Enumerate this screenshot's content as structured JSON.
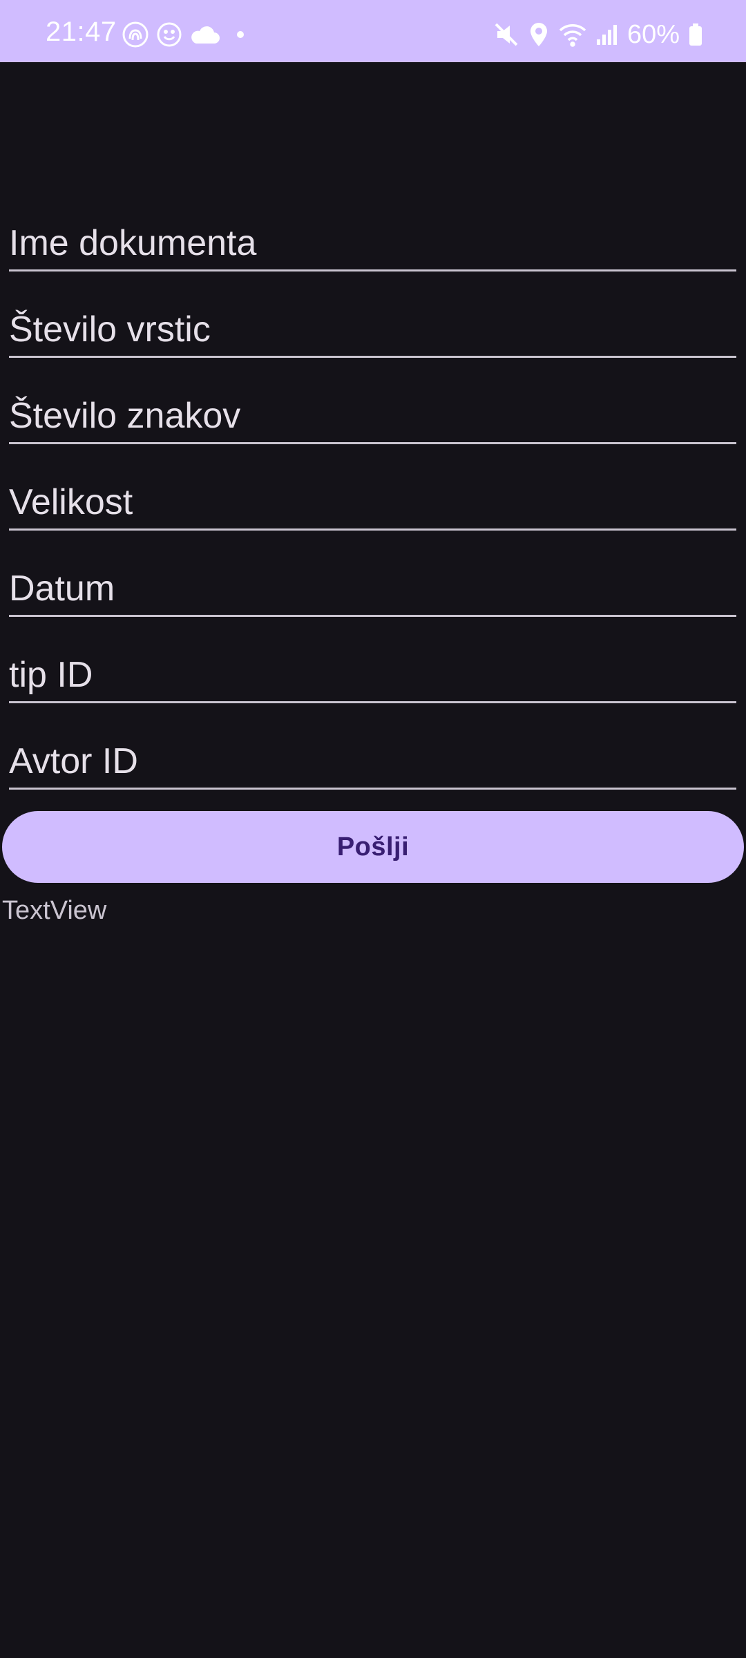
{
  "status_bar": {
    "time": "21:47",
    "battery": "60%",
    "left_icons": [
      "fingerprint-icon",
      "face-icon",
      "cloud-icon",
      "dot-icon"
    ],
    "right_icons": [
      "mute-icon",
      "location-icon",
      "wifi-icon",
      "signal-icon",
      "battery-icon"
    ],
    "background": "#d0bcff"
  },
  "form": {
    "fields": [
      {
        "placeholder": "Ime dokumenta",
        "value": ""
      },
      {
        "placeholder": "Število vrstic",
        "value": ""
      },
      {
        "placeholder": "Število znakov",
        "value": ""
      },
      {
        "placeholder": "Velikost",
        "value": ""
      },
      {
        "placeholder": "Datum",
        "value": ""
      },
      {
        "placeholder": "tip ID",
        "value": ""
      },
      {
        "placeholder": "Avtor ID",
        "value": ""
      }
    ],
    "submit_label": "Pošlji",
    "result_text": "TextView"
  },
  "colors": {
    "background": "#141218",
    "accent": "#d0bcff",
    "on_accent": "#381e72",
    "text": "#e6e0e9"
  }
}
